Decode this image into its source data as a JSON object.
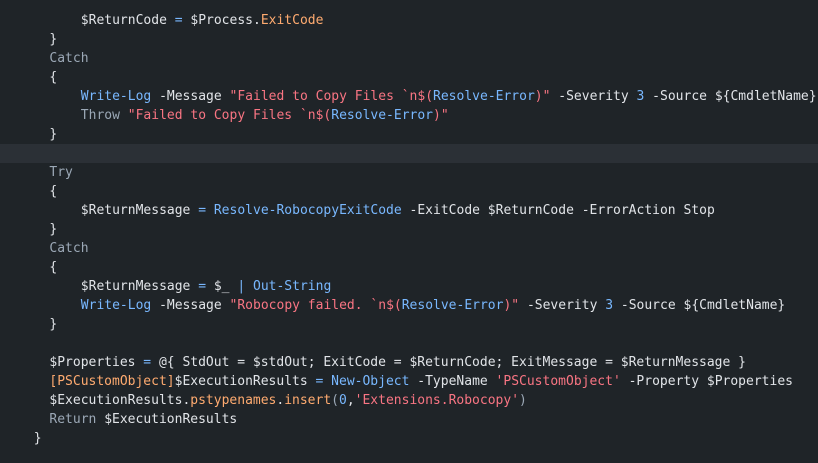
{
  "colors": {
    "background": "#1f2428",
    "current_line": "#2b3036",
    "default": "#e1e4e8",
    "keyword": "#9ba8b6",
    "variable": "#e1e4e8",
    "cmdlet": "#79b8ff",
    "string": "#f97583",
    "number": "#79b8ff",
    "property": "#ffab70",
    "operator": "#79b8ff",
    "type": "#ffab70"
  },
  "editor": {
    "current_line_index": 7,
    "lines": [
      {
        "indent": 8,
        "tokens": [
          {
            "t": "$ReturnCode",
            "c": "variable"
          },
          {
            "t": " = ",
            "c": "operator"
          },
          {
            "t": "$Process",
            "c": "variable"
          },
          {
            "t": ".",
            "c": "default"
          },
          {
            "t": "ExitCode",
            "c": "property"
          }
        ]
      },
      {
        "indent": 4,
        "tokens": [
          {
            "t": "}",
            "c": "default"
          }
        ]
      },
      {
        "indent": 4,
        "tokens": [
          {
            "t": "Catch",
            "c": "keyword"
          }
        ]
      },
      {
        "indent": 4,
        "tokens": [
          {
            "t": "{",
            "c": "default"
          }
        ]
      },
      {
        "indent": 8,
        "tokens": [
          {
            "t": "Write-Log",
            "c": "cmdlet"
          },
          {
            "t": " -Message ",
            "c": "default"
          },
          {
            "t": "\"Failed to Copy Files `n$(",
            "c": "string"
          },
          {
            "t": "Resolve-Error",
            "c": "cmdlet"
          },
          {
            "t": ")\"",
            "c": "string"
          },
          {
            "t": " -Severity ",
            "c": "default"
          },
          {
            "t": "3",
            "c": "number"
          },
          {
            "t": " -Source ",
            "c": "default"
          },
          {
            "t": "${CmdletName}",
            "c": "variable"
          }
        ]
      },
      {
        "indent": 8,
        "tokens": [
          {
            "t": "Throw",
            "c": "keyword"
          },
          {
            "t": " ",
            "c": "default"
          },
          {
            "t": "\"Failed to Copy Files `n$(",
            "c": "string"
          },
          {
            "t": "Resolve-Error",
            "c": "cmdlet"
          },
          {
            "t": ")\"",
            "c": "string"
          }
        ]
      },
      {
        "indent": 4,
        "tokens": [
          {
            "t": "}",
            "c": "default"
          }
        ]
      },
      {
        "indent": 0,
        "tokens": []
      },
      {
        "indent": 4,
        "tokens": [
          {
            "t": "Try",
            "c": "keyword"
          }
        ]
      },
      {
        "indent": 4,
        "tokens": [
          {
            "t": "{",
            "c": "default"
          }
        ]
      },
      {
        "indent": 8,
        "tokens": [
          {
            "t": "$ReturnMessage",
            "c": "variable"
          },
          {
            "t": " = ",
            "c": "operator"
          },
          {
            "t": "Resolve-RobocopyExitCode",
            "c": "cmdlet"
          },
          {
            "t": " -ExitCode ",
            "c": "default"
          },
          {
            "t": "$ReturnCode",
            "c": "variable"
          },
          {
            "t": " -ErrorAction Stop",
            "c": "default"
          }
        ]
      },
      {
        "indent": 4,
        "tokens": [
          {
            "t": "}",
            "c": "default"
          }
        ]
      },
      {
        "indent": 4,
        "tokens": [
          {
            "t": "Catch",
            "c": "keyword"
          }
        ]
      },
      {
        "indent": 4,
        "tokens": [
          {
            "t": "{",
            "c": "default"
          }
        ]
      },
      {
        "indent": 8,
        "tokens": [
          {
            "t": "$ReturnMessage",
            "c": "variable"
          },
          {
            "t": " = ",
            "c": "operator"
          },
          {
            "t": "$_",
            "c": "variable"
          },
          {
            "t": " | ",
            "c": "operator"
          },
          {
            "t": "Out-String",
            "c": "cmdlet"
          }
        ]
      },
      {
        "indent": 8,
        "tokens": [
          {
            "t": "Write-Log",
            "c": "cmdlet"
          },
          {
            "t": " -Message ",
            "c": "default"
          },
          {
            "t": "\"Robocopy failed. `n$(",
            "c": "string"
          },
          {
            "t": "Resolve-Error",
            "c": "cmdlet"
          },
          {
            "t": ")\"",
            "c": "string"
          },
          {
            "t": " -Severity ",
            "c": "default"
          },
          {
            "t": "3",
            "c": "number"
          },
          {
            "t": " -Source ",
            "c": "default"
          },
          {
            "t": "${CmdletName}",
            "c": "variable"
          }
        ]
      },
      {
        "indent": 4,
        "tokens": [
          {
            "t": "}",
            "c": "default"
          }
        ]
      },
      {
        "indent": 0,
        "tokens": []
      },
      {
        "indent": 4,
        "tokens": [
          {
            "t": "$Properties",
            "c": "variable"
          },
          {
            "t": " = ",
            "c": "operator"
          },
          {
            "t": "@{ StdOut = ",
            "c": "default"
          },
          {
            "t": "$stdOut",
            "c": "variable"
          },
          {
            "t": "; ExitCode = ",
            "c": "default"
          },
          {
            "t": "$ReturnCode",
            "c": "variable"
          },
          {
            "t": "; ExitMessage = ",
            "c": "default"
          },
          {
            "t": "$ReturnMessage",
            "c": "variable"
          },
          {
            "t": " }",
            "c": "default"
          }
        ]
      },
      {
        "indent": 4,
        "tokens": [
          {
            "t": "[PSCustomObject]",
            "c": "type"
          },
          {
            "t": "$ExecutionResults",
            "c": "variable"
          },
          {
            "t": " = ",
            "c": "operator"
          },
          {
            "t": "New-Object",
            "c": "cmdlet"
          },
          {
            "t": " -TypeName ",
            "c": "default"
          },
          {
            "t": "'PSCustomObject'",
            "c": "string"
          },
          {
            "t": " -Property ",
            "c": "default"
          },
          {
            "t": "$Properties",
            "c": "variable"
          }
        ]
      },
      {
        "indent": 4,
        "tokens": [
          {
            "t": "$ExecutionResults",
            "c": "variable"
          },
          {
            "t": ".",
            "c": "default"
          },
          {
            "t": "pstypenames",
            "c": "property"
          },
          {
            "t": ".",
            "c": "default"
          },
          {
            "t": "insert",
            "c": "property"
          },
          {
            "t": "(",
            "c": "keyword"
          },
          {
            "t": "0",
            "c": "number"
          },
          {
            "t": ",",
            "c": "default"
          },
          {
            "t": "'Extensions.Robocopy'",
            "c": "string"
          },
          {
            "t": ")",
            "c": "keyword"
          }
        ]
      },
      {
        "indent": 4,
        "tokens": [
          {
            "t": "Return",
            "c": "keyword"
          },
          {
            "t": " ",
            "c": "default"
          },
          {
            "t": "$ExecutionResults",
            "c": "variable"
          }
        ]
      },
      {
        "indent": 2,
        "tokens": [
          {
            "t": "}",
            "c": "default"
          }
        ]
      }
    ]
  }
}
